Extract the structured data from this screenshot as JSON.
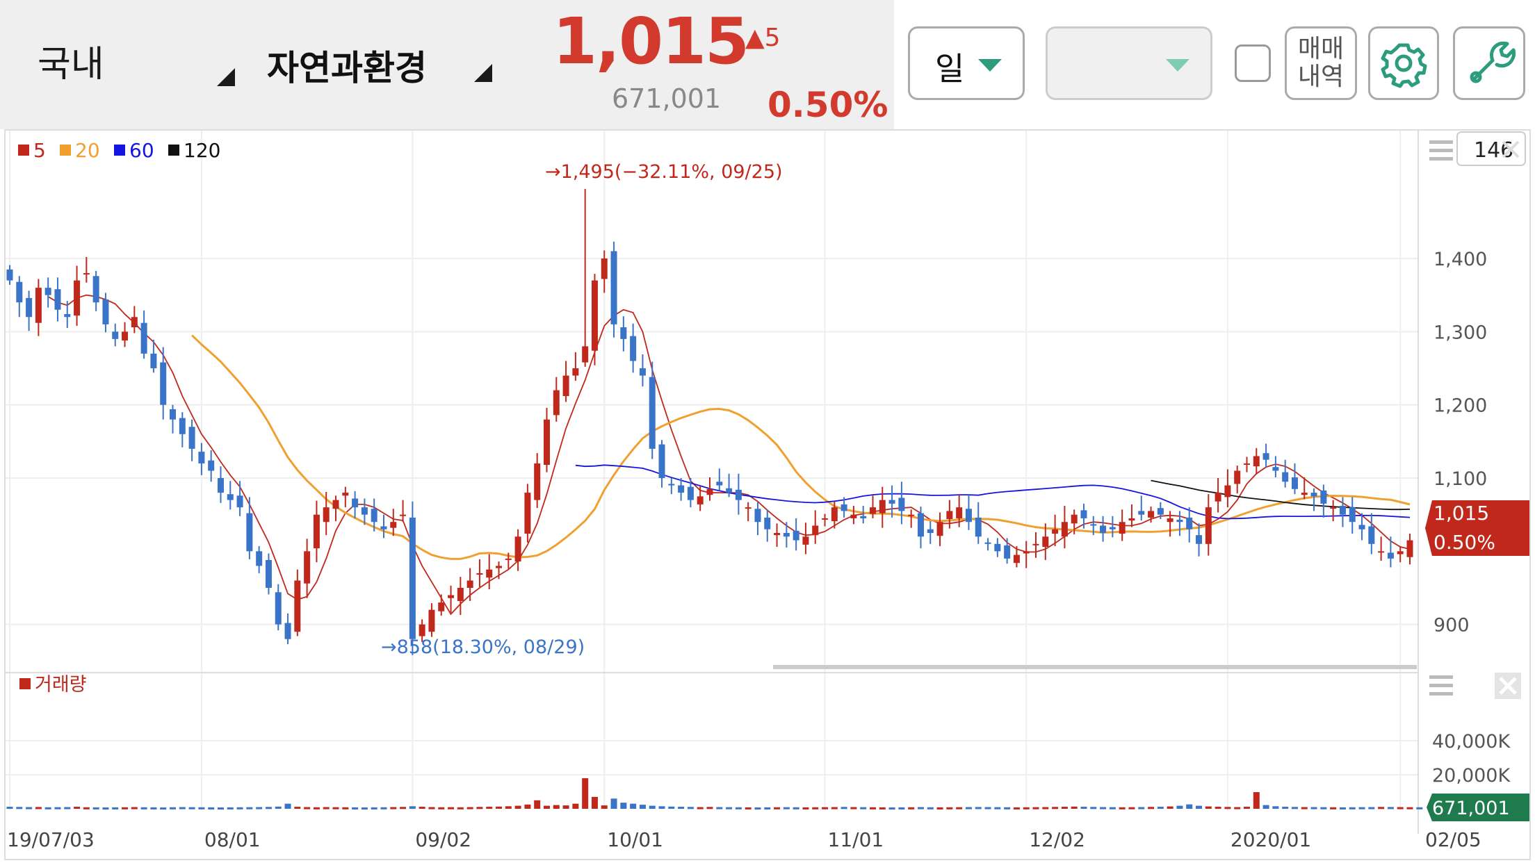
{
  "header": {
    "market_label": "국내",
    "sector_label": "자연과환경",
    "price": "1,015",
    "change": "▲5",
    "volume": "671,001",
    "change_pct": "0.50%",
    "period_label": "일",
    "trade_history_line1": "매매",
    "trade_history_line2": "내역",
    "colors": {
      "up": "#d23a2e",
      "down": "#3a74c8",
      "accent": "#2c9c7c"
    }
  },
  "price_panel": {
    "legend": [
      {
        "label": "5",
        "color": "#c0281c"
      },
      {
        "label": "20",
        "color": "#f0a030"
      },
      {
        "label": "60",
        "color": "#1414e0"
      },
      {
        "label": "120",
        "color": "#111111"
      }
    ],
    "count_box": "146",
    "current_price_tag": "1,015",
    "current_pct_tag": "0.50%",
    "high_annotation": "→1,495(−32.11%, 09/25)",
    "low_annotation": "→858(18.30%, 08/29)"
  },
  "volume_panel": {
    "legend_label": "거래량",
    "current_volume_tag": "671,001"
  },
  "chart_data": {
    "type": "candlestick",
    "price_axis": {
      "ticks": [
        900,
        1100,
        1200,
        1300,
        1400
      ],
      "tick_labels": [
        "900",
        "1,100",
        "1,200",
        "1,300",
        "1,400"
      ]
    },
    "volume_axis": {
      "ticks": [
        20000,
        40000
      ],
      "tick_labels": [
        "20,000K",
        "40,000K"
      ]
    },
    "x_labels": [
      "19/07/03",
      "08/01",
      "09/02",
      "10/01",
      "11/01",
      "12/02",
      "2020/01",
      "02/05"
    ],
    "x_label_positions": [
      0,
      20,
      42,
      62,
      85,
      106,
      127,
      145
    ],
    "high": {
      "value": 1495,
      "index": 60
    },
    "low": {
      "value": 858,
      "index": 42
    },
    "closes": [
      1370,
      1340,
      1320,
      1360,
      1350,
      1330,
      1320,
      1370,
      1380,
      1340,
      1310,
      1290,
      1300,
      1320,
      1270,
      1250,
      1200,
      1180,
      1160,
      1140,
      1120,
      1110,
      1080,
      1070,
      1060,
      1000,
      980,
      950,
      900,
      880,
      960,
      1000,
      1050,
      1060,
      1070,
      1080,
      1060,
      1050,
      1040,
      1030,
      1040,
      1050,
      880,
      900,
      920,
      930,
      940,
      950,
      960,
      970,
      975,
      980,
      990,
      1020,
      1080,
      1120,
      1180,
      1220,
      1240,
      1250,
      1280,
      1370,
      1400,
      1310,
      1290,
      1260,
      1240,
      1140,
      1100,
      1090,
      1080,
      1070,
      1075,
      1085,
      1090,
      1080,
      1070,
      1060,
      1040,
      1030,
      1025,
      1020,
      1015,
      1020,
      1035,
      1045,
      1060,
      1055,
      1050,
      1045,
      1060,
      1070,
      1065,
      1055,
      1050,
      1020,
      1025,
      1040,
      1055,
      1060,
      1040,
      1020,
      1010,
      1000,
      990,
      995,
      1000,
      1010,
      1020,
      1030,
      1040,
      1050,
      1045,
      1035,
      1025,
      1030,
      1040,
      1045,
      1050,
      1055,
      1050,
      1045,
      1040,
      1030,
      1010,
      1060,
      1080,
      1090,
      1110,
      1120,
      1130,
      1125,
      1110,
      1095,
      1085,
      1080,
      1075,
      1065,
      1060,
      1050,
      1040,
      1030,
      1010,
      1000,
      990,
      1000,
      1015
    ],
    "volumes": [
      1200,
      1100,
      1000,
      1050,
      900,
      950,
      1000,
      1200,
      900,
      850,
      800,
      850,
      900,
      1000,
      900,
      850,
      800,
      900,
      1000,
      950,
      900,
      850,
      800,
      850,
      900,
      950,
      1000,
      1100,
      1300,
      3000,
      1200,
      1000,
      900,
      1000,
      950,
      900,
      850,
      800,
      850,
      900,
      1000,
      1100,
      1500,
      1200,
      1000,
      900,
      950,
      900,
      1000,
      1100,
      1200,
      1300,
      1500,
      1800,
      2500,
      5000,
      1800,
      2200,
      2000,
      3000,
      18000,
      7000,
      2000,
      6000,
      3600,
      3000,
      2400,
      1800,
      1500,
      1300,
      1200,
      1100,
      1000,
      1100,
      1000,
      950,
      900,
      850,
      800,
      850,
      900,
      950,
      900,
      850,
      900,
      950,
      1000,
      1100,
      1000,
      950,
      900,
      850,
      800,
      850,
      900,
      1000,
      900,
      850,
      900,
      950,
      1000,
      1050,
      1000,
      950,
      900,
      850,
      900,
      950,
      1000,
      1100,
      1200,
      1300,
      1200,
      1100,
      1000,
      950,
      900,
      950,
      1000,
      1100,
      1200,
      1400,
      1800,
      2600,
      1800,
      1400,
      1200,
      1100,
      1000,
      1200,
      9800,
      2200,
      1500,
      1200,
      1100,
      1000,
      1000,
      950,
      900,
      850,
      900,
      950,
      1000,
      1100,
      1050,
      1000,
      950,
      900
    ]
  }
}
